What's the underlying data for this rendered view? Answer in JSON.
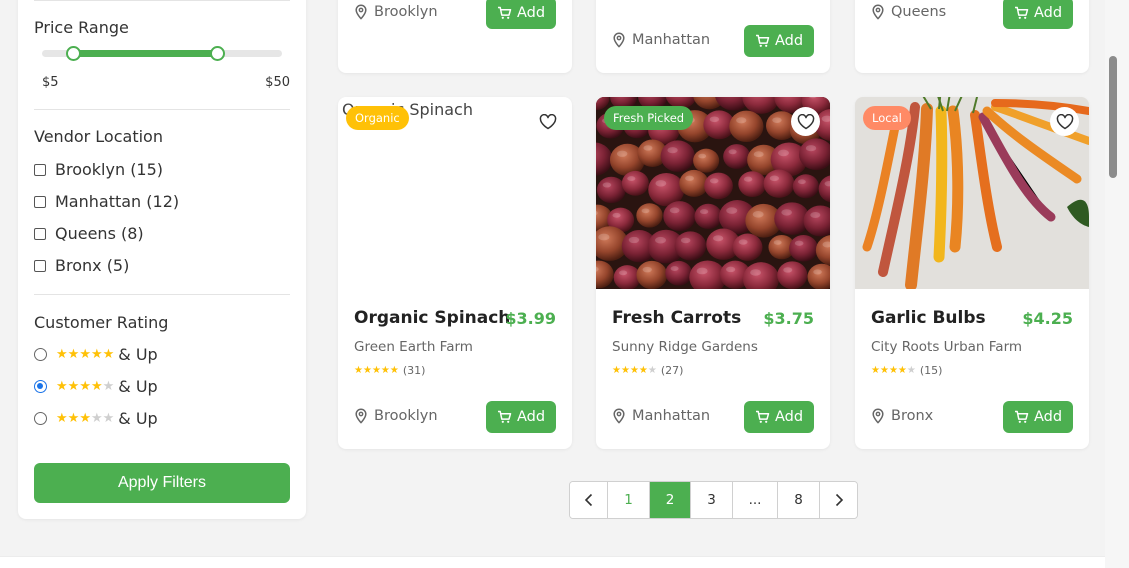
{
  "filters": {
    "price": {
      "title": "Price Range",
      "min_label": "$5",
      "max_label": "$50",
      "selected_min_fraction": 0.13,
      "selected_max_fraction": 0.73
    },
    "vendor_location": {
      "title": "Vendor Location",
      "options": [
        "Brooklyn (15)",
        "Manhattan (12)",
        "Queens (8)",
        "Bronx (5)"
      ]
    },
    "customer_rating": {
      "title": "Customer Rating",
      "options": [
        {
          "stars": 5,
          "label": "& Up",
          "selected": false
        },
        {
          "stars": 4,
          "label": "& Up",
          "selected": true
        },
        {
          "stars": 3,
          "label": "& Up",
          "selected": false
        }
      ]
    },
    "apply_label": "Apply Filters"
  },
  "top_row": [
    {
      "location": "Brooklyn",
      "add_label": "Add"
    },
    {
      "location": "Manhattan",
      "add_label": "Add"
    },
    {
      "location": "Queens",
      "add_label": "Add"
    }
  ],
  "products": [
    {
      "name": "Organic Spinach",
      "image_alt": "Organic Spinach",
      "badge": "Organic",
      "badge_color": "#ffc107",
      "price": "$3.99",
      "vendor": "Green Earth Farm",
      "rating": 5,
      "reviews": "(31)",
      "location": "Brooklyn",
      "add_label": "Add"
    },
    {
      "name": "Fresh Carrots",
      "badge": "Fresh Picked",
      "badge_color": "#4caf50",
      "price": "$3.75",
      "vendor": "Sunny Ridge Gardens",
      "rating": 4,
      "reviews": "(27)",
      "location": "Manhattan",
      "add_label": "Add"
    },
    {
      "name": "Garlic Bulbs",
      "badge": "Local",
      "badge_color": "#ff8a65",
      "price": "$4.25",
      "vendor": "City Roots Urban Farm",
      "rating": 4,
      "reviews": "(15)",
      "location": "Bronx",
      "add_label": "Add"
    }
  ],
  "pagination": {
    "prev_icon": "chevron-left-icon",
    "next_icon": "chevron-right-icon",
    "pages": [
      "1",
      "2",
      "3",
      "...",
      "8"
    ],
    "current": "2"
  },
  "colors": {
    "accent": "#4caf50",
    "star": "#ffc107",
    "radio_selected": "#1a73e8"
  }
}
